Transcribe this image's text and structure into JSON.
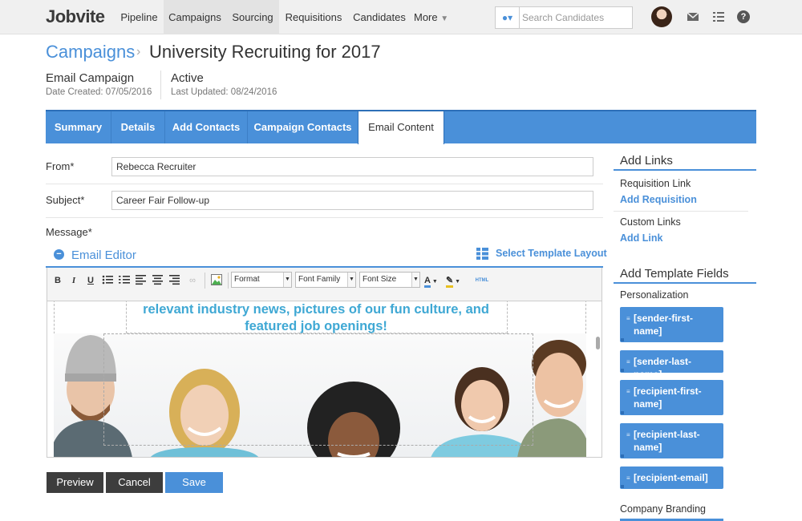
{
  "nav": {
    "logo": "Jobvite",
    "tabs": [
      {
        "label": "Pipeline",
        "active": false
      },
      {
        "label": "Campaigns",
        "active": true
      },
      {
        "label": "Sourcing",
        "active": false
      },
      {
        "label": "Requisitions",
        "active": false
      },
      {
        "label": "Candidates",
        "active": false
      },
      {
        "label": "More",
        "active": false
      }
    ],
    "search_placeholder": "Search Candidates",
    "icons": [
      "person-search-icon",
      "avatar",
      "mail-icon",
      "list-icon",
      "help-icon"
    ]
  },
  "breadcrumb": {
    "root": "Campaigns",
    "current": "University Recruiting for 2017"
  },
  "meta": {
    "type": "Email Campaign",
    "created": "Date Created: 07/05/2016",
    "status": "Active",
    "updated": "Last Updated: 08/24/2016"
  },
  "tabs": [
    {
      "label": "Summary",
      "active": false
    },
    {
      "label": "Details",
      "active": false
    },
    {
      "label": "Add Contacts",
      "active": false
    },
    {
      "label": "Campaign Contacts",
      "active": false
    },
    {
      "label": "Email Content",
      "active": true
    }
  ],
  "form": {
    "from_label": "From*",
    "from_value": "Rebecca Recruiter",
    "subject_label": "Subject*",
    "subject_value": "Career Fair Follow-up",
    "message_label": "Message*"
  },
  "editor": {
    "title": "Email Editor",
    "template_link": "Select Template Layout",
    "format": "Format",
    "font_family": "Font Family",
    "font_size": "Font Size",
    "html_btn": "HTML",
    "promo_line1": "relevant industry news, pictures of our fun culture, and",
    "promo_line2": "featured job openings!"
  },
  "actions": {
    "preview": "Preview",
    "cancel": "Cancel",
    "save": "Save"
  },
  "sidebar": {
    "add_links_title": "Add Links",
    "req_link_label": "Requisition Link",
    "req_link_action": "Add Requisition",
    "custom_links_label": "Custom Links",
    "custom_link_action": "Add Link",
    "template_fields_title": "Add Template Fields",
    "personalization_label": "Personalization",
    "fields": [
      "[sender-first-name]",
      "[sender-last-name]",
      "[recipient-first-name]",
      "[recipient-last-name]",
      "[recipient-email]"
    ],
    "company_branding_label": "Company Branding"
  },
  "colors": {
    "accent": "#4a90d9",
    "dark_button": "#3d3d3d",
    "promo_text": "#3fa8d4"
  }
}
